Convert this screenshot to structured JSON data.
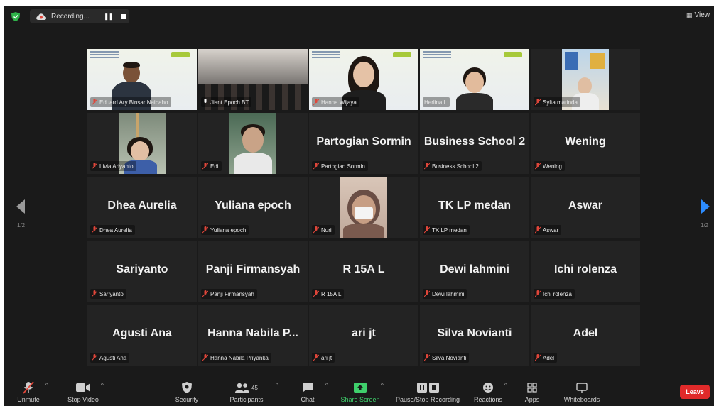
{
  "topbar": {
    "recording_label": "Recording...",
    "view_label": "View"
  },
  "navigation": {
    "page_left": "1/2",
    "page_right": "1/2"
  },
  "participants": [
    {
      "label": "Eduard Ary Binsar Naibaho",
      "display": "",
      "kind": "video-slide",
      "active": true
    },
    {
      "label": "Jiant Epoch BT",
      "display": "",
      "kind": "video-room"
    },
    {
      "label": "Hanna Wijaya",
      "display": "",
      "kind": "video-slide-woman"
    },
    {
      "label": "Herlina L",
      "display": "",
      "kind": "video-slide-woman2"
    },
    {
      "label": "Sylta marinda",
      "display": "",
      "kind": "video-small"
    },
    {
      "label": "Livia Ariyanto",
      "display": "",
      "kind": "video-small"
    },
    {
      "label": "Edi",
      "display": "",
      "kind": "video-small"
    },
    {
      "label": "Partogian Sormin",
      "display": "Partogian Sormin",
      "kind": "name"
    },
    {
      "label": "Business School 2",
      "display": "Business School 2",
      "kind": "name"
    },
    {
      "label": "Wening",
      "display": "Wening",
      "kind": "name"
    },
    {
      "label": "Dhea Aurelia",
      "display": "Dhea Aurelia",
      "kind": "name"
    },
    {
      "label": "Yuliana epoch",
      "display": "Yuliana epoch",
      "kind": "name"
    },
    {
      "label": "Nuri",
      "display": "",
      "kind": "video-small"
    },
    {
      "label": "TK LP medan",
      "display": "TK LP medan",
      "kind": "name"
    },
    {
      "label": "Aswar",
      "display": "Aswar",
      "kind": "name"
    },
    {
      "label": "Sariyanto",
      "display": "Sariyanto",
      "kind": "name"
    },
    {
      "label": "Panji Firmansyah",
      "display": "Panji Firmansyah",
      "kind": "name"
    },
    {
      "label": "R 15A L",
      "display": "R 15A L",
      "kind": "name"
    },
    {
      "label": "Dewi lahmini",
      "display": "Dewi lahmini",
      "kind": "name"
    },
    {
      "label": "Ichi rolenza",
      "display": "Ichi rolenza",
      "kind": "name"
    },
    {
      "label": "Agusti Ana",
      "display": "Agusti Ana",
      "kind": "name"
    },
    {
      "label": "Hanna Nabila Priyanka",
      "display": "Hanna Nabila P...",
      "kind": "name"
    },
    {
      "label": "ari jt",
      "display": "ari jt",
      "kind": "name"
    },
    {
      "label": "Silva Novianti",
      "display": "Silva Novianti",
      "kind": "name"
    },
    {
      "label": "Adel",
      "display": "Adel",
      "kind": "name"
    }
  ],
  "toolbar": {
    "unmute": "Unmute",
    "stop_video": "Stop Video",
    "security": "Security",
    "participants": "Participants",
    "participant_count": "45",
    "chat": "Chat",
    "share_screen": "Share Screen",
    "recording": "Pause/Stop Recording",
    "reactions": "Reactions",
    "apps": "Apps",
    "whiteboards": "Whiteboards",
    "leave": "Leave"
  },
  "colors": {
    "background": "#1a1a1a",
    "tile": "#232323",
    "active_border": "#c6e23a",
    "share_green": "#3fd06c",
    "leave_red": "#e02a2a",
    "muted_red": "#e0463a",
    "nav_arrow_right": "#2d8cff"
  }
}
